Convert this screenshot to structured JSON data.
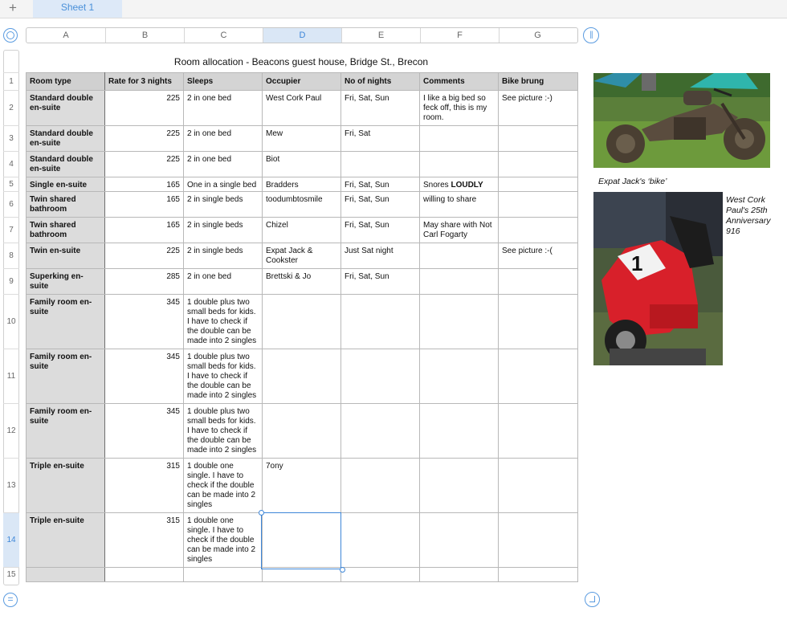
{
  "toolbar": {
    "add_sheet": "+",
    "sheet_tab": "Sheet 1"
  },
  "columns": [
    "A",
    "B",
    "C",
    "D",
    "E",
    "F",
    "G"
  ],
  "selected_column": "D",
  "rows": [
    "1",
    "2",
    "3",
    "4",
    "5",
    "6",
    "7",
    "8",
    "9",
    "10",
    "11",
    "12",
    "13",
    "14",
    "15"
  ],
  "selected_row": "14",
  "table": {
    "title": "Room allocation - Beacons guest house, Bridge St., Brecon",
    "headers": [
      "Room type",
      "Rate for 3 nights",
      "Sleeps",
      "Occupier",
      "No of nights",
      "Comments",
      "Bike brung"
    ],
    "data": [
      [
        "Standard double en-suite",
        "225",
        "2 in one bed",
        "West Cork Paul",
        "Fri, Sat, Sun",
        "I like a big bed so feck off, this is my room.",
        "See picture :-)"
      ],
      [
        "Standard double en-suite",
        "225",
        "2 in one bed",
        "Mew",
        "Fri, Sat",
        "",
        ""
      ],
      [
        "Standard double en-suite",
        "225",
        "2 in one bed",
        "Biot",
        "",
        "",
        ""
      ],
      [
        "Single en-suite",
        "165",
        "One in a single bed",
        "Bradders",
        "Fri, Sat, Sun",
        "Snores ",
        ""
      ],
      [
        "Twin shared bathroom",
        "165",
        "2 in single beds",
        "toodumbtosmile",
        "Fri, Sat, Sun",
        "willing to share",
        ""
      ],
      [
        "Twin shared bathroom",
        "165",
        "2 in single beds",
        "Chizel",
        "Fri, Sat, Sun",
        "May share with Not Carl Fogarty",
        ""
      ],
      [
        "Twin en-suite",
        "225",
        "2 in single beds",
        "Expat Jack & Cookster",
        "Just Sat night",
        "",
        "See picture :-("
      ],
      [
        "Superking en-suite",
        "285",
        "2 in one bed",
        "Brettski & Jo",
        "Fri, Sat, Sun",
        "",
        ""
      ],
      [
        "Family room en-suite",
        "345",
        "1 double plus two small beds for kids. I have to check if the double can be made into 2 singles",
        "",
        "",
        "",
        ""
      ],
      [
        "Family room en-suite",
        "345",
        "1 double plus two small beds for kids. I have to check if the double can be made into 2 singles",
        "",
        "",
        "",
        ""
      ],
      [
        "Family room en-suite",
        "345",
        "1 double plus two small beds for kids. I have to check if the double can be made into 2 singles",
        "",
        "",
        "",
        ""
      ],
      [
        "Triple en-suite",
        "315",
        "1 double one single. I have to check if the double can be made into 2 singles",
        "7ony",
        "",
        "",
        ""
      ],
      [
        "Triple en-suite",
        "315",
        "1 double one single. I have to check if the double can be made into 2 singles",
        "",
        "",
        "",
        ""
      ],
      [
        "",
        "",
        "",
        "",
        "",
        "",
        ""
      ]
    ],
    "loudly_bold": "LOUDLY"
  },
  "images": {
    "bike_caption": "Expat Jack's ‘bike’",
    "scooter_caption": "West Cork Paul's 25th Anniversary 916"
  },
  "colors": {
    "accent": "#3d86d8",
    "header_fill": "#d4d4d4",
    "scooter_red": "#d8202a"
  }
}
